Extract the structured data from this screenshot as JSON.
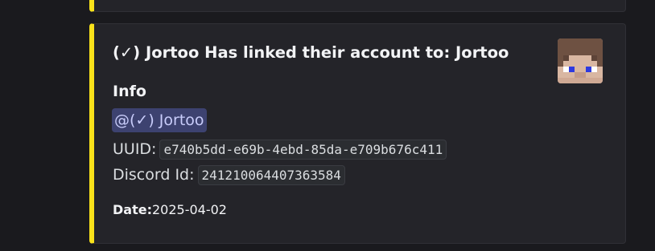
{
  "embed": {
    "accent_color": "#f9e21a",
    "title": "(✓) Jortoo Has linked their account to: Jortoo",
    "field": {
      "name": "Info",
      "mention": "@(✓) Jortoo",
      "uuid_label": "UUID:",
      "uuid_value": "e740b5dd-e69b-4ebd-85da-e709b676c411",
      "discord_label": "Discord Id:",
      "discord_value": "241210064407363584"
    },
    "footer": {
      "date_label": "Date:",
      "date_value": "2025-04-02"
    },
    "thumbnail": {
      "icon": "minecraft-skin-face-icon"
    }
  }
}
